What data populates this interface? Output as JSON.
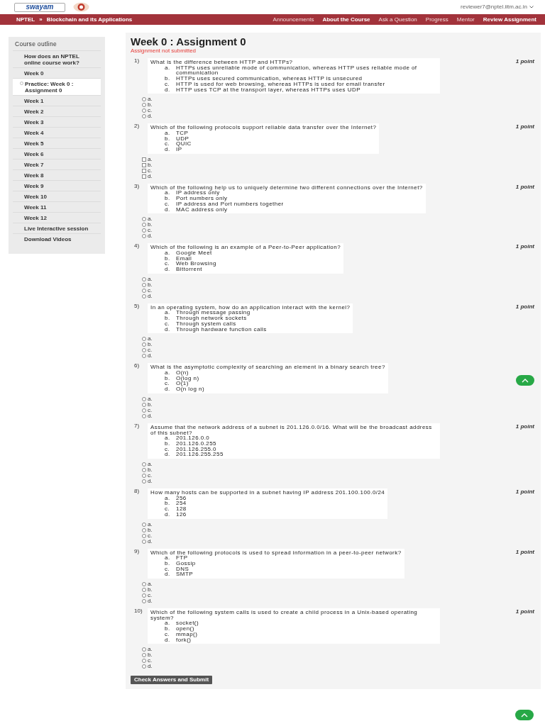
{
  "header": {
    "logo_text": "swayam",
    "user_email": "reviewer7@nptel.iitm.ac.in"
  },
  "nav": {
    "breadcrumb": [
      "NPTEL",
      "»",
      "Blockchain and its Applications"
    ],
    "links": [
      {
        "label": "Announcements",
        "selected": false
      },
      {
        "label": "About the Course",
        "selected": true
      },
      {
        "label": "Ask a Question",
        "selected": false
      },
      {
        "label": "Progress",
        "selected": false
      },
      {
        "label": "Mentor",
        "selected": false
      },
      {
        "label": "Review Assignment",
        "selected": true
      }
    ]
  },
  "sidebar": {
    "title": "Course outline",
    "items": [
      {
        "label": "How does an NPTEL online course work?",
        "selected": false
      },
      {
        "label": "Week 0",
        "selected": false,
        "children": [
          {
            "label": "Practice: Week 0 : Assignment 0",
            "selected": true
          }
        ]
      },
      {
        "label": "Week 1",
        "selected": false
      },
      {
        "label": "Week 2",
        "selected": false
      },
      {
        "label": "Week 3",
        "selected": false
      },
      {
        "label": "Week 4",
        "selected": false
      },
      {
        "label": "Week 5",
        "selected": false
      },
      {
        "label": "Week 6",
        "selected": false
      },
      {
        "label": "Week 7",
        "selected": false
      },
      {
        "label": "Week 8",
        "selected": false
      },
      {
        "label": "Week 9",
        "selected": false
      },
      {
        "label": "Week 10",
        "selected": false
      },
      {
        "label": "Week 11",
        "selected": false
      },
      {
        "label": "Week 12",
        "selected": false
      },
      {
        "label": "Live Interactive session",
        "selected": false
      },
      {
        "label": "Download Videos",
        "selected": false
      }
    ]
  },
  "assignment": {
    "title": "Week 0 : Assignment 0",
    "status": "Assignment not submitted",
    "submit_label": "Check Answers and Submit",
    "questions": [
      {
        "number": "1)",
        "kind": "radio",
        "points": "1 point",
        "text": "What is the difference between HTTP and HTTPs?",
        "options": [
          {
            "letter": "a.",
            "text": "HTTPs uses unreliable mode of communication, whereas HTTP uses reliable mode of communication"
          },
          {
            "letter": "b.",
            "text": "HTTPs uses secured communication, whereas HTTP is unsecured"
          },
          {
            "letter": "c.",
            "text": "HTTP is used for web browsing, whereas HTTPs is used for email transfer"
          },
          {
            "letter": "d.",
            "text": "HTTP uses TCP at the transport layer, whereas HTTPs uses UDP"
          }
        ],
        "answers": [
          {
            "label": "a.",
            "selected": false
          },
          {
            "label": "b.",
            "selected": false
          },
          {
            "label": "c.",
            "selected": false
          },
          {
            "label": "d.",
            "selected": false
          }
        ]
      },
      {
        "number": "2)",
        "kind": "checkbox",
        "points": "1 point",
        "text": "Which of the following protocols support reliable data transfer over the Internet?",
        "options": [
          {
            "letter": "a.",
            "text": "TCP"
          },
          {
            "letter": "b.",
            "text": "UDP"
          },
          {
            "letter": "c.",
            "text": "QUIC"
          },
          {
            "letter": "d.",
            "text": "IP"
          }
        ],
        "answers": [
          {
            "label": "a.",
            "selected": false
          },
          {
            "label": "b.",
            "selected": false
          },
          {
            "label": "c.",
            "selected": false
          },
          {
            "label": "d.",
            "selected": false
          }
        ]
      },
      {
        "number": "3)",
        "kind": "radio",
        "points": "1 point",
        "text": "Which of the following help us to uniquely determine two different connections over the Internet?",
        "options": [
          {
            "letter": "a.",
            "text": "IP address only"
          },
          {
            "letter": "b.",
            "text": "Port numbers only"
          },
          {
            "letter": "c.",
            "text": "IP address and Port numbers together"
          },
          {
            "letter": "d.",
            "text": "MAC address only"
          }
        ],
        "answers": [
          {
            "label": "a.",
            "selected": false
          },
          {
            "label": "b.",
            "selected": false
          },
          {
            "label": "c.",
            "selected": false
          },
          {
            "label": "d.",
            "selected": false
          }
        ]
      },
      {
        "number": "4)",
        "kind": "radio",
        "points": "1 point",
        "text": "Which of the following is an example of a Peer-to-Peer application?",
        "options": [
          {
            "letter": "a.",
            "text": "Google Meet"
          },
          {
            "letter": "b.",
            "text": "Email"
          },
          {
            "letter": "c.",
            "text": "Web Browsing"
          },
          {
            "letter": "d.",
            "text": "Bittorrent"
          }
        ],
        "answers": [
          {
            "label": "a.",
            "selected": false
          },
          {
            "label": "b.",
            "selected": false
          },
          {
            "label": "c.",
            "selected": false
          },
          {
            "label": "d.",
            "selected": false
          }
        ]
      },
      {
        "number": "5)",
        "kind": "radio",
        "points": "1 point",
        "text": "In an operating system, how do an application interact with the kernel?",
        "options": [
          {
            "letter": "a.",
            "text": "Through message passing"
          },
          {
            "letter": "b.",
            "text": "Through network sockets"
          },
          {
            "letter": "c.",
            "text": "Through system calls"
          },
          {
            "letter": "d.",
            "text": "Through hardware function calls"
          }
        ],
        "answers": [
          {
            "label": "a.",
            "selected": false
          },
          {
            "label": "b.",
            "selected": false
          },
          {
            "label": "c.",
            "selected": false
          },
          {
            "label": "d.",
            "selected": false
          }
        ]
      },
      {
        "number": "6)",
        "kind": "radio",
        "text": "What is the asymptotic complexity of searching an element in a binary search tree?",
        "options": [
          {
            "letter": "a.",
            "text": "O(n)"
          },
          {
            "letter": "b.",
            "text": "O(log n)"
          },
          {
            "letter": "c.",
            "text": "O(1)"
          },
          {
            "letter": "d.",
            "text": "O(n log n)"
          }
        ],
        "answers": [
          {
            "label": "a.",
            "selected": false
          },
          {
            "label": "b.",
            "selected": false
          },
          {
            "label": "c.",
            "selected": false
          },
          {
            "label": "d.",
            "selected": false
          }
        ]
      },
      {
        "number": "7)",
        "kind": "radio",
        "points": "1 point",
        "text": "Assume that the network address of a subnet is 201.126.0.0/16. What will be the broadcast address of this subnet?",
        "options": [
          {
            "letter": "a.",
            "text": "201.126.0.0"
          },
          {
            "letter": "b.",
            "text": "201.126.0.255"
          },
          {
            "letter": "c.",
            "text": "201.126.255.0"
          },
          {
            "letter": "d.",
            "text": "201.126.255.255"
          }
        ],
        "answers": [
          {
            "label": "a.",
            "selected": false
          },
          {
            "label": "b.",
            "selected": false
          },
          {
            "label": "c.",
            "selected": false
          },
          {
            "label": "d.",
            "selected": false
          }
        ]
      },
      {
        "number": "8)",
        "kind": "radio",
        "points": "1 point",
        "text": "How many hosts can be supported in a subnet having IP address 201.100.100.0/24",
        "options": [
          {
            "letter": "a.",
            "text": "256"
          },
          {
            "letter": "b.",
            "text": "254"
          },
          {
            "letter": "c.",
            "text": "128"
          },
          {
            "letter": "d.",
            "text": "126"
          }
        ],
        "answers": [
          {
            "label": "a.",
            "selected": false
          },
          {
            "label": "b.",
            "selected": false
          },
          {
            "label": "c.",
            "selected": false
          },
          {
            "label": "d.",
            "selected": false
          }
        ]
      },
      {
        "number": "9)",
        "kind": "radio",
        "points": "1 point",
        "text": "Which of the following protocols is used to spread information in a peer-to-peer network?",
        "options": [
          {
            "letter": "a.",
            "text": "FTP"
          },
          {
            "letter": "b.",
            "text": "Gossip"
          },
          {
            "letter": "c.",
            "text": "DNS"
          },
          {
            "letter": "d.",
            "text": "SMTP"
          }
        ],
        "answers": [
          {
            "label": "a.",
            "selected": false
          },
          {
            "label": "b.",
            "selected": false
          },
          {
            "label": "c.",
            "selected": false
          },
          {
            "label": "d.",
            "selected": false
          }
        ]
      },
      {
        "number": "10)",
        "kind": "radio",
        "points": "1 point",
        "text": "Which of the following system calls is used to create a child process in a Unix-based operating system?",
        "options": [
          {
            "letter": "a.",
            "text": "socket()"
          },
          {
            "letter": "b.",
            "text": "open()"
          },
          {
            "letter": "c.",
            "text": "mmap()"
          },
          {
            "letter": "d.",
            "text": "fork()"
          }
        ],
        "answers": [
          {
            "label": "a.",
            "selected": false
          },
          {
            "label": "b.",
            "selected": false
          },
          {
            "label": "c.",
            "selected": false
          },
          {
            "label": "d.",
            "selected": false
          }
        ]
      }
    ]
  }
}
